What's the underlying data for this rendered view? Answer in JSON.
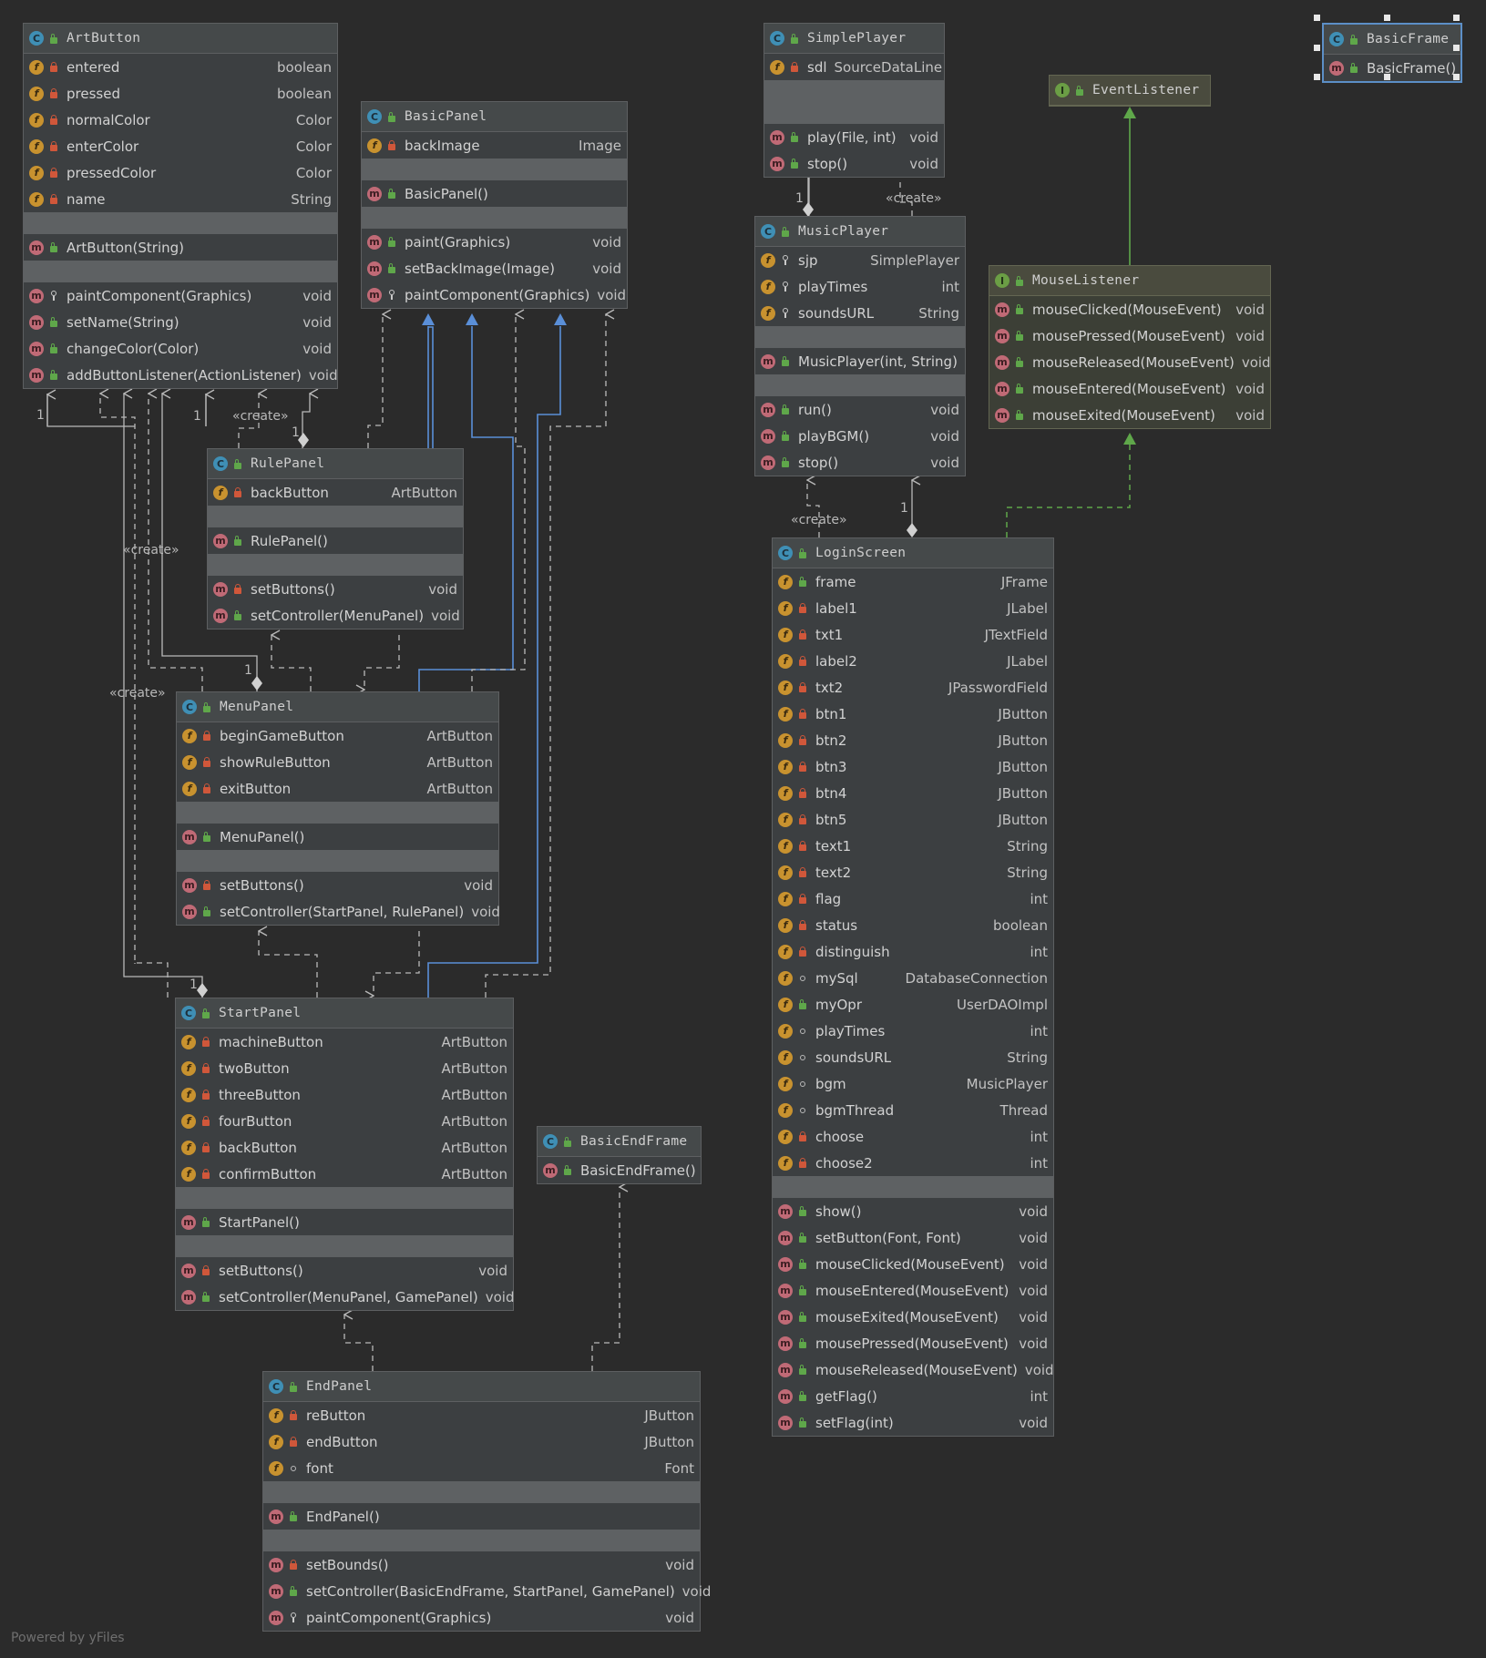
{
  "footer": "Powered by yFiles",
  "labels": {
    "create": "«create»",
    "one": "1"
  },
  "colors": {
    "background": "#2b2b2b",
    "class_body": "#3c3f41",
    "implements_arrow": "#5a8fd8",
    "realization_arrow": "#5fa74a",
    "dependency_line": "#b9b9b9"
  },
  "classes": [
    {
      "id": "ArtButton",
      "kind": "class",
      "name": "ArtButton",
      "fields": [
        {
          "vis": "priv",
          "name": "entered",
          "type": "boolean"
        },
        {
          "vis": "priv",
          "name": "pressed",
          "type": "boolean"
        },
        {
          "vis": "priv",
          "name": "normalColor",
          "type": "Color"
        },
        {
          "vis": "priv",
          "name": "enterColor",
          "type": "Color"
        },
        {
          "vis": "priv",
          "name": "pressedColor",
          "type": "Color"
        },
        {
          "vis": "priv",
          "name": "name",
          "type": "String"
        }
      ],
      "ctors": [
        {
          "vis": "pub",
          "name": "ArtButton(String)",
          "type": ""
        }
      ],
      "methods": [
        {
          "vis": "prot",
          "name": "paintComponent(Graphics)",
          "type": "void"
        },
        {
          "vis": "pub",
          "name": "setName(String)",
          "type": "void"
        },
        {
          "vis": "pub",
          "name": "changeColor(Color)",
          "type": "void"
        },
        {
          "vis": "pub",
          "name": "addButtonListener(ActionListener)",
          "type": "void"
        }
      ]
    },
    {
      "id": "BasicPanel",
      "kind": "class",
      "name": "BasicPanel",
      "fields": [
        {
          "vis": "priv",
          "name": "backImage",
          "type": "Image"
        }
      ],
      "ctors": [
        {
          "vis": "pub",
          "name": "BasicPanel()",
          "type": ""
        }
      ],
      "methods": [
        {
          "vis": "pub",
          "name": "paint(Graphics)",
          "type": "void"
        },
        {
          "vis": "pub",
          "name": "setBackImage(Image)",
          "type": "void"
        },
        {
          "vis": "prot",
          "name": "paintComponent(Graphics)",
          "type": "void"
        }
      ]
    },
    {
      "id": "SimplePlayer",
      "kind": "class",
      "name": "SimplePlayer",
      "fields": [
        {
          "vis": "priv",
          "name": "sdl",
          "type": "SourceDataLine"
        }
      ],
      "ctors": [],
      "methods": [
        {
          "vis": "pub",
          "name": "play(File, int)",
          "type": "void"
        },
        {
          "vis": "pub",
          "name": "stop()",
          "type": "void"
        }
      ]
    },
    {
      "id": "BasicFrame",
      "kind": "class",
      "name": "BasicFrame",
      "selected": true,
      "fields": null,
      "ctors": [
        {
          "vis": "pub",
          "name": "BasicFrame()",
          "type": ""
        }
      ],
      "methods": null
    },
    {
      "id": "EventListener",
      "kind": "iface",
      "name": "EventListener",
      "fields": null,
      "ctors": null,
      "methods": null
    },
    {
      "id": "MusicPlayer",
      "kind": "class",
      "name": "MusicPlayer",
      "fields": [
        {
          "vis": "prot",
          "name": "sjp",
          "type": "SimplePlayer"
        },
        {
          "vis": "prot",
          "name": "playTimes",
          "type": "int"
        },
        {
          "vis": "prot",
          "name": "soundsURL",
          "type": "String"
        }
      ],
      "ctors": [
        {
          "vis": "pub",
          "name": "MusicPlayer(int, String)",
          "type": ""
        }
      ],
      "methods": [
        {
          "vis": "pub",
          "name": "run()",
          "type": "void"
        },
        {
          "vis": "pub",
          "name": "playBGM()",
          "type": "void"
        },
        {
          "vis": "pub",
          "name": "stop()",
          "type": "void"
        }
      ]
    },
    {
      "id": "MouseListener",
      "kind": "iface",
      "name": "MouseListener",
      "fields": null,
      "ctors": null,
      "methods": [
        {
          "vis": "pub",
          "name": "mouseClicked(MouseEvent)",
          "type": "void"
        },
        {
          "vis": "pub",
          "name": "mousePressed(MouseEvent)",
          "type": "void"
        },
        {
          "vis": "pub",
          "name": "mouseReleased(MouseEvent)",
          "type": "void"
        },
        {
          "vis": "pub",
          "name": "mouseEntered(MouseEvent)",
          "type": "void"
        },
        {
          "vis": "pub",
          "name": "mouseExited(MouseEvent)",
          "type": "void"
        }
      ]
    },
    {
      "id": "RulePanel",
      "kind": "class",
      "name": "RulePanel",
      "fields": [
        {
          "vis": "priv",
          "name": "backButton",
          "type": "ArtButton"
        }
      ],
      "ctors": [
        {
          "vis": "pub",
          "name": "RulePanel()",
          "type": ""
        }
      ],
      "methods": [
        {
          "vis": "priv",
          "name": "setButtons()",
          "type": "void"
        },
        {
          "vis": "pub",
          "name": "setController(MenuPanel)",
          "type": "void"
        }
      ]
    },
    {
      "id": "MenuPanel",
      "kind": "class",
      "name": "MenuPanel",
      "fields": [
        {
          "vis": "priv",
          "name": "beginGameButton",
          "type": "ArtButton"
        },
        {
          "vis": "priv",
          "name": "showRuleButton",
          "type": "ArtButton"
        },
        {
          "vis": "priv",
          "name": "exitButton",
          "type": "ArtButton"
        }
      ],
      "ctors": [
        {
          "vis": "pub",
          "name": "MenuPanel()",
          "type": ""
        }
      ],
      "methods": [
        {
          "vis": "priv",
          "name": "setButtons()",
          "type": "void"
        },
        {
          "vis": "pub",
          "name": "setController(StartPanel, RulePanel)",
          "type": "void"
        }
      ]
    },
    {
      "id": "LoginScreen",
      "kind": "class",
      "name": "LoginScreen",
      "fields": [
        {
          "vis": "pub",
          "name": "frame",
          "type": "JFrame"
        },
        {
          "vis": "priv",
          "name": "label1",
          "type": "JLabel"
        },
        {
          "vis": "priv",
          "name": "txt1",
          "type": "JTextField"
        },
        {
          "vis": "priv",
          "name": "label2",
          "type": "JLabel"
        },
        {
          "vis": "priv",
          "name": "txt2",
          "type": "JPasswordField"
        },
        {
          "vis": "priv",
          "name": "btn1",
          "type": "JButton"
        },
        {
          "vis": "priv",
          "name": "btn2",
          "type": "JButton"
        },
        {
          "vis": "priv",
          "name": "btn3",
          "type": "JButton"
        },
        {
          "vis": "priv",
          "name": "btn4",
          "type": "JButton"
        },
        {
          "vis": "priv",
          "name": "btn5",
          "type": "JButton"
        },
        {
          "vis": "priv",
          "name": "text1",
          "type": "String"
        },
        {
          "vis": "priv",
          "name": "text2",
          "type": "String"
        },
        {
          "vis": "priv",
          "name": "flag",
          "type": "int"
        },
        {
          "vis": "priv",
          "name": "status",
          "type": "boolean"
        },
        {
          "vis": "priv",
          "name": "distinguish",
          "type": "int"
        },
        {
          "vis": "pkg",
          "name": "mySql",
          "type": "DatabaseConnection"
        },
        {
          "vis": "pub",
          "name": "myOpr",
          "type": "UserDAOImpl"
        },
        {
          "vis": "pkg",
          "name": "playTimes",
          "type": "int"
        },
        {
          "vis": "pkg",
          "name": "soundsURL",
          "type": "String"
        },
        {
          "vis": "pkg",
          "name": "bgm",
          "type": "MusicPlayer"
        },
        {
          "vis": "pkg",
          "name": "bgmThread",
          "type": "Thread"
        },
        {
          "vis": "priv",
          "name": "choose",
          "type": "int"
        },
        {
          "vis": "priv",
          "name": "choose2",
          "type": "int"
        }
      ],
      "ctors": null,
      "methods": [
        {
          "vis": "pub",
          "name": "show()",
          "type": "void"
        },
        {
          "vis": "pub",
          "name": "setButton(Font, Font)",
          "type": "void"
        },
        {
          "vis": "pub",
          "name": "mouseClicked(MouseEvent)",
          "type": "void"
        },
        {
          "vis": "pub",
          "name": "mouseEntered(MouseEvent)",
          "type": "void"
        },
        {
          "vis": "pub",
          "name": "mouseExited(MouseEvent)",
          "type": "void"
        },
        {
          "vis": "pub",
          "name": "mousePressed(MouseEvent)",
          "type": "void"
        },
        {
          "vis": "pub",
          "name": "mouseReleased(MouseEvent)",
          "type": "void"
        },
        {
          "vis": "pub",
          "name": "getFlag()",
          "type": "int"
        },
        {
          "vis": "pub",
          "name": "setFlag(int)",
          "type": "void"
        }
      ]
    },
    {
      "id": "StartPanel",
      "kind": "class",
      "name": "StartPanel",
      "fields": [
        {
          "vis": "priv",
          "name": "machineButton",
          "type": "ArtButton"
        },
        {
          "vis": "priv",
          "name": "twoButton",
          "type": "ArtButton"
        },
        {
          "vis": "priv",
          "name": "threeButton",
          "type": "ArtButton"
        },
        {
          "vis": "priv",
          "name": "fourButton",
          "type": "ArtButton"
        },
        {
          "vis": "priv",
          "name": "backButton",
          "type": "ArtButton"
        },
        {
          "vis": "priv",
          "name": "confirmButton",
          "type": "ArtButton"
        }
      ],
      "ctors": [
        {
          "vis": "pub",
          "name": "StartPanel()",
          "type": ""
        }
      ],
      "methods": [
        {
          "vis": "priv",
          "name": "setButtons()",
          "type": "void"
        },
        {
          "vis": "pub",
          "name": "setController(MenuPanel, GamePanel)",
          "type": "void"
        }
      ]
    },
    {
      "id": "BasicEndFrame",
      "kind": "class",
      "name": "BasicEndFrame",
      "fields": null,
      "ctors": [
        {
          "vis": "pub",
          "name": "BasicEndFrame()",
          "type": ""
        }
      ],
      "methods": null
    },
    {
      "id": "EndPanel",
      "kind": "class",
      "name": "EndPanel",
      "fields": [
        {
          "vis": "priv",
          "name": "reButton",
          "type": "JButton"
        },
        {
          "vis": "priv",
          "name": "endButton",
          "type": "JButton"
        },
        {
          "vis": "pkg",
          "name": "font",
          "type": "Font"
        }
      ],
      "ctors": [
        {
          "vis": "pub",
          "name": "EndPanel()",
          "type": ""
        }
      ],
      "methods": [
        {
          "vis": "priv",
          "name": "setBounds()",
          "type": "void"
        },
        {
          "vis": "pub",
          "name": "setController(BasicEndFrame, StartPanel, GamePanel)",
          "type": "void"
        },
        {
          "vis": "prot",
          "name": "paintComponent(Graphics)",
          "type": "void"
        }
      ]
    }
  ]
}
